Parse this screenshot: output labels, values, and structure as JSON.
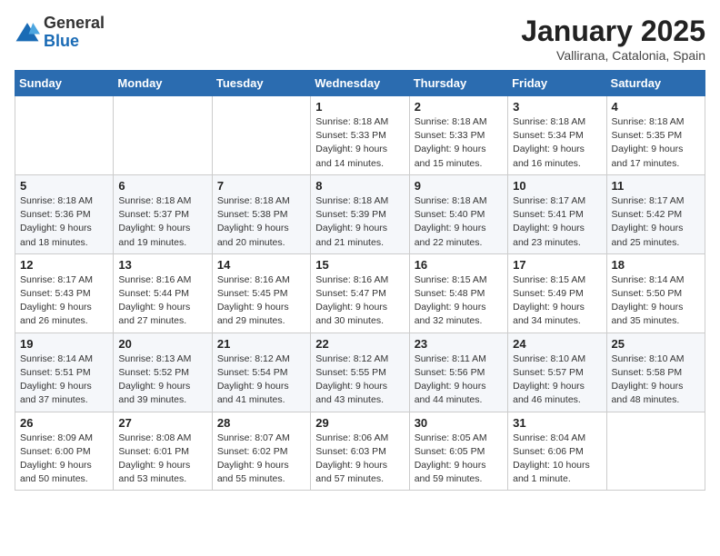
{
  "header": {
    "logo_general": "General",
    "logo_blue": "Blue",
    "title": "January 2025",
    "subtitle": "Vallirana, Catalonia, Spain"
  },
  "weekdays": [
    "Sunday",
    "Monday",
    "Tuesday",
    "Wednesday",
    "Thursday",
    "Friday",
    "Saturday"
  ],
  "weeks": [
    [
      {
        "day": "",
        "info": ""
      },
      {
        "day": "",
        "info": ""
      },
      {
        "day": "",
        "info": ""
      },
      {
        "day": "1",
        "info": "Sunrise: 8:18 AM\nSunset: 5:33 PM\nDaylight: 9 hours\nand 14 minutes."
      },
      {
        "day": "2",
        "info": "Sunrise: 8:18 AM\nSunset: 5:33 PM\nDaylight: 9 hours\nand 15 minutes."
      },
      {
        "day": "3",
        "info": "Sunrise: 8:18 AM\nSunset: 5:34 PM\nDaylight: 9 hours\nand 16 minutes."
      },
      {
        "day": "4",
        "info": "Sunrise: 8:18 AM\nSunset: 5:35 PM\nDaylight: 9 hours\nand 17 minutes."
      }
    ],
    [
      {
        "day": "5",
        "info": "Sunrise: 8:18 AM\nSunset: 5:36 PM\nDaylight: 9 hours\nand 18 minutes."
      },
      {
        "day": "6",
        "info": "Sunrise: 8:18 AM\nSunset: 5:37 PM\nDaylight: 9 hours\nand 19 minutes."
      },
      {
        "day": "7",
        "info": "Sunrise: 8:18 AM\nSunset: 5:38 PM\nDaylight: 9 hours\nand 20 minutes."
      },
      {
        "day": "8",
        "info": "Sunrise: 8:18 AM\nSunset: 5:39 PM\nDaylight: 9 hours\nand 21 minutes."
      },
      {
        "day": "9",
        "info": "Sunrise: 8:18 AM\nSunset: 5:40 PM\nDaylight: 9 hours\nand 22 minutes."
      },
      {
        "day": "10",
        "info": "Sunrise: 8:17 AM\nSunset: 5:41 PM\nDaylight: 9 hours\nand 23 minutes."
      },
      {
        "day": "11",
        "info": "Sunrise: 8:17 AM\nSunset: 5:42 PM\nDaylight: 9 hours\nand 25 minutes."
      }
    ],
    [
      {
        "day": "12",
        "info": "Sunrise: 8:17 AM\nSunset: 5:43 PM\nDaylight: 9 hours\nand 26 minutes."
      },
      {
        "day": "13",
        "info": "Sunrise: 8:16 AM\nSunset: 5:44 PM\nDaylight: 9 hours\nand 27 minutes."
      },
      {
        "day": "14",
        "info": "Sunrise: 8:16 AM\nSunset: 5:45 PM\nDaylight: 9 hours\nand 29 minutes."
      },
      {
        "day": "15",
        "info": "Sunrise: 8:16 AM\nSunset: 5:47 PM\nDaylight: 9 hours\nand 30 minutes."
      },
      {
        "day": "16",
        "info": "Sunrise: 8:15 AM\nSunset: 5:48 PM\nDaylight: 9 hours\nand 32 minutes."
      },
      {
        "day": "17",
        "info": "Sunrise: 8:15 AM\nSunset: 5:49 PM\nDaylight: 9 hours\nand 34 minutes."
      },
      {
        "day": "18",
        "info": "Sunrise: 8:14 AM\nSunset: 5:50 PM\nDaylight: 9 hours\nand 35 minutes."
      }
    ],
    [
      {
        "day": "19",
        "info": "Sunrise: 8:14 AM\nSunset: 5:51 PM\nDaylight: 9 hours\nand 37 minutes."
      },
      {
        "day": "20",
        "info": "Sunrise: 8:13 AM\nSunset: 5:52 PM\nDaylight: 9 hours\nand 39 minutes."
      },
      {
        "day": "21",
        "info": "Sunrise: 8:12 AM\nSunset: 5:54 PM\nDaylight: 9 hours\nand 41 minutes."
      },
      {
        "day": "22",
        "info": "Sunrise: 8:12 AM\nSunset: 5:55 PM\nDaylight: 9 hours\nand 43 minutes."
      },
      {
        "day": "23",
        "info": "Sunrise: 8:11 AM\nSunset: 5:56 PM\nDaylight: 9 hours\nand 44 minutes."
      },
      {
        "day": "24",
        "info": "Sunrise: 8:10 AM\nSunset: 5:57 PM\nDaylight: 9 hours\nand 46 minutes."
      },
      {
        "day": "25",
        "info": "Sunrise: 8:10 AM\nSunset: 5:58 PM\nDaylight: 9 hours\nand 48 minutes."
      }
    ],
    [
      {
        "day": "26",
        "info": "Sunrise: 8:09 AM\nSunset: 6:00 PM\nDaylight: 9 hours\nand 50 minutes."
      },
      {
        "day": "27",
        "info": "Sunrise: 8:08 AM\nSunset: 6:01 PM\nDaylight: 9 hours\nand 53 minutes."
      },
      {
        "day": "28",
        "info": "Sunrise: 8:07 AM\nSunset: 6:02 PM\nDaylight: 9 hours\nand 55 minutes."
      },
      {
        "day": "29",
        "info": "Sunrise: 8:06 AM\nSunset: 6:03 PM\nDaylight: 9 hours\nand 57 minutes."
      },
      {
        "day": "30",
        "info": "Sunrise: 8:05 AM\nSunset: 6:05 PM\nDaylight: 9 hours\nand 59 minutes."
      },
      {
        "day": "31",
        "info": "Sunrise: 8:04 AM\nSunset: 6:06 PM\nDaylight: 10 hours\nand 1 minute."
      },
      {
        "day": "",
        "info": ""
      }
    ]
  ]
}
